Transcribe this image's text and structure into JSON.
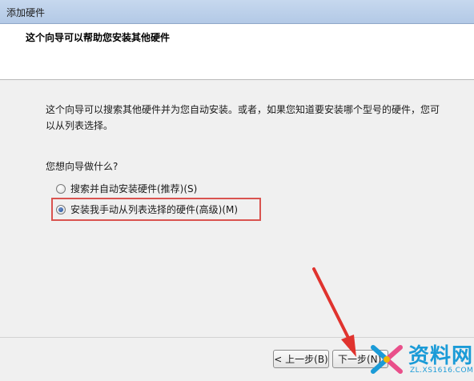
{
  "window": {
    "title": "添加硬件"
  },
  "header": {
    "title": "这个向导可以帮助您安装其他硬件"
  },
  "content": {
    "intro": "这个向导可以搜索其他硬件并为您自动安装。或者，如果您知道要安装哪个型号的硬件，您可以从列表选择。",
    "question": "您想向导做什么?",
    "options": [
      {
        "label": "搜索并自动安装硬件(推荐)(S)",
        "selected": false
      },
      {
        "label": "安装我手动从列表选择的硬件(高级)(M)",
        "selected": true
      }
    ]
  },
  "buttons": {
    "back": "< 上一步(B)",
    "next": "下一步(N)"
  },
  "watermark": {
    "text": "资料网",
    "sub": "ZL.XS1616.COM"
  },
  "colors": {
    "highlight": "#d9534f",
    "arrow": "#e0332e",
    "watermark": "#1b9bd7"
  }
}
